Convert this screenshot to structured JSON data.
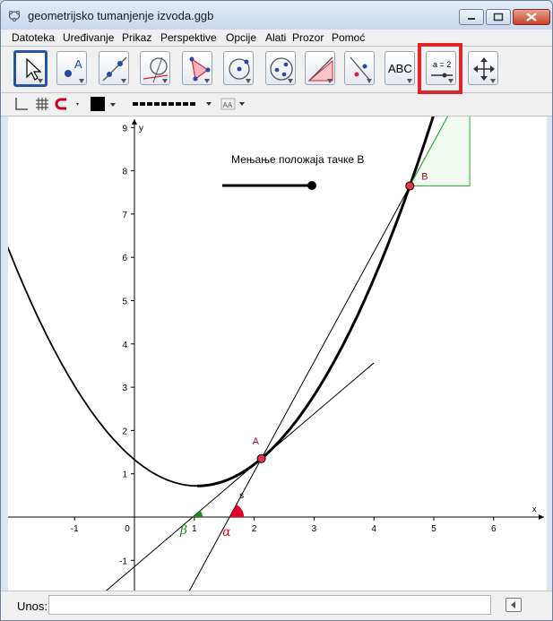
{
  "window": {
    "title": "geometrijsko tumanjenje izvoda.ggb"
  },
  "menu": {
    "items": [
      "Datoteka",
      "Uređivanje",
      "Prikaz",
      "Perspektive",
      "Opcije",
      "Alati",
      "Prozor",
      "Pomoć"
    ]
  },
  "toolbar": {
    "text_tool_label": "ABC",
    "slider_tool_label": "a = 2"
  },
  "input_bar": {
    "label": "Unos:",
    "value": ""
  },
  "graphics": {
    "slider_caption": "Мењање положаја тачке B",
    "slider_value": 1.0,
    "point_a_label": "A",
    "point_b_label": "B",
    "point_s_label": "s",
    "angle_alpha_label": "α",
    "angle_beta_label": "β",
    "axis_x_label": "x",
    "axis_y_label": "y",
    "x_ticks": [
      "-1",
      "0",
      "1",
      "2",
      "3",
      "4",
      "5",
      "6"
    ],
    "y_ticks": [
      "-1",
      "1",
      "2",
      "3",
      "4",
      "5",
      "6",
      "7",
      "8",
      "9"
    ],
    "origin_label": "0"
  },
  "colors": {
    "point_fill": "#e8334a",
    "angle_alpha": "#e0002a",
    "angle_beta": "#1b8a1b",
    "slope_triangle": "#23b523",
    "highlight": "#e0262b"
  }
}
